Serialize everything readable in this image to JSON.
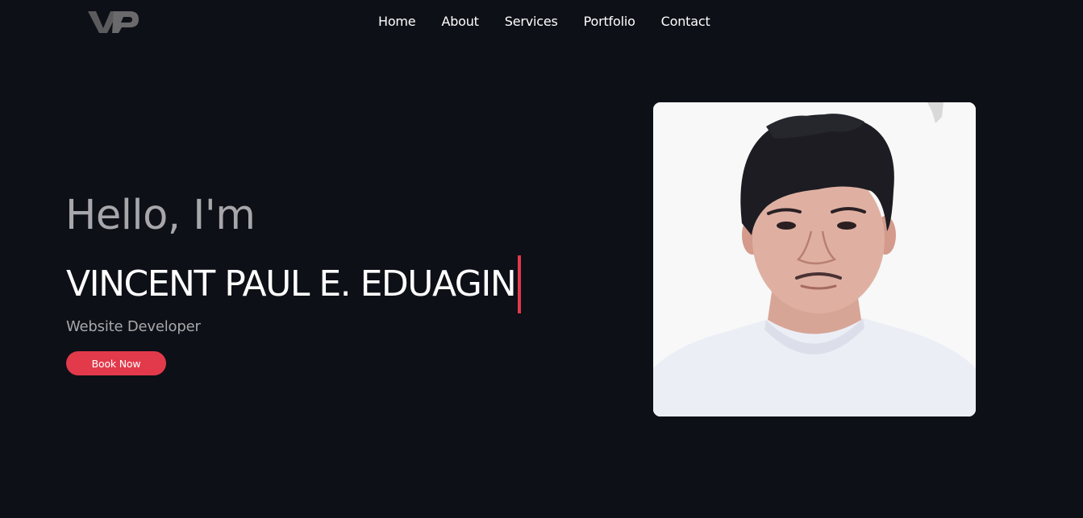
{
  "nav": {
    "items": [
      "Home",
      "About",
      "Services",
      "Portfolio",
      "Contact"
    ]
  },
  "hero": {
    "greeting": "Hello, I'm",
    "name": "VINCENT PAUL E. EDUAGIN",
    "role": "Website Developer",
    "cta_label": "Book Now"
  },
  "colors": {
    "background": "#0e1017",
    "accent": "#e23a4b",
    "muted_text": "#a7a7ab",
    "text": "#ffffff"
  },
  "icons": {
    "logo": "vp-logo-icon"
  }
}
